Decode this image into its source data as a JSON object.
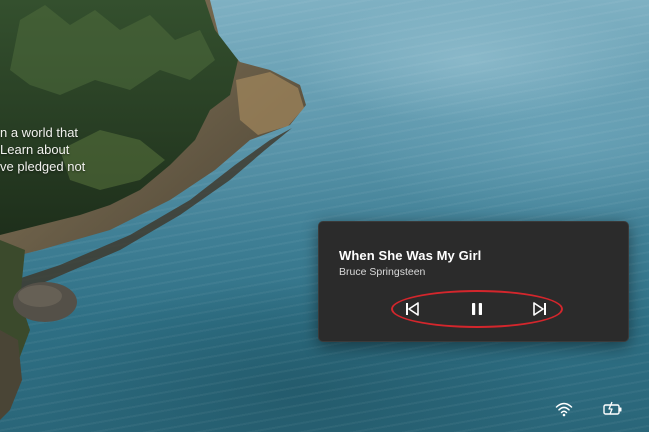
{
  "desktop": {
    "text_lines": [
      "n a world that",
      "Learn about",
      "ve pledged not"
    ]
  },
  "media": {
    "title": "When She Was My Girl",
    "artist": "Bruce Springsteen",
    "controls": {
      "previous_icon": "skip-previous-icon",
      "pause_icon": "pause-icon",
      "next_icon": "skip-next-icon"
    },
    "highlight_color": "#d4262c"
  },
  "tray": {
    "wifi_icon": "wifi-icon",
    "battery_icon": "battery-charging-icon"
  }
}
